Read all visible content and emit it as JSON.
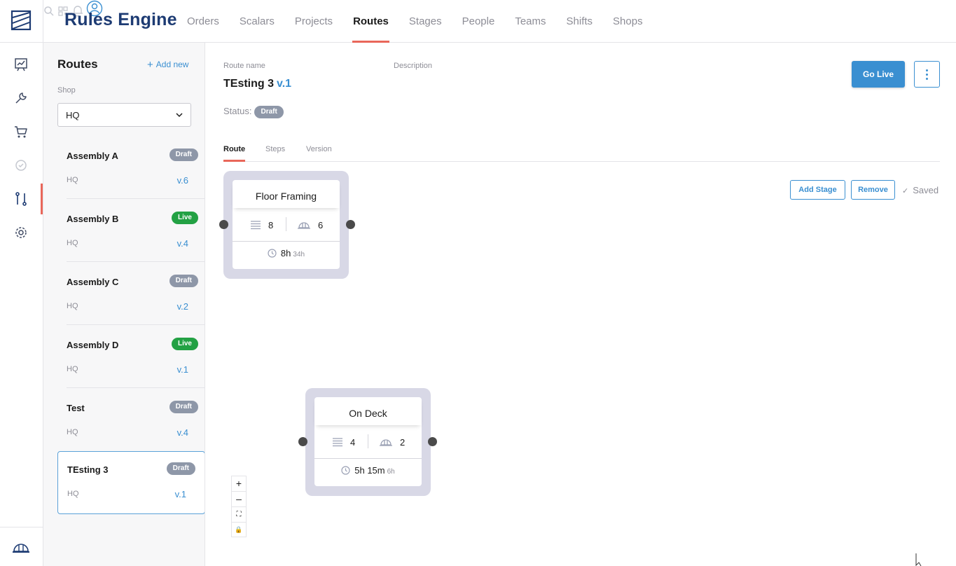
{
  "app": {
    "brand": "Rules Engine"
  },
  "nav": {
    "tabs": [
      {
        "label": "Orders"
      },
      {
        "label": "Scalars"
      },
      {
        "label": "Projects"
      },
      {
        "label": "Routes",
        "active": true
      },
      {
        "label": "Stages"
      },
      {
        "label": "People"
      },
      {
        "label": "Teams"
      },
      {
        "label": "Shifts"
      },
      {
        "label": "Shops"
      }
    ]
  },
  "rail": {
    "icons": [
      "dashboard-chart-icon",
      "wrench-icon",
      "cart-icon",
      "check-circle-icon",
      "routes-icon",
      "gear-icon",
      "hard-hat-icon"
    ],
    "active": "routes-icon"
  },
  "topicons": [
    "search-icon",
    "qr-code-icon",
    "bell-icon",
    "user-avatar-icon"
  ],
  "panel": {
    "title": "Routes",
    "add_new": "Add new",
    "shop_label": "Shop",
    "shop_value": "HQ",
    "items": [
      {
        "name": "Assembly A",
        "status": "Draft",
        "shop": "HQ",
        "version": "v.6"
      },
      {
        "name": "Assembly B",
        "status": "Live",
        "shop": "HQ",
        "version": "v.4"
      },
      {
        "name": "Assembly C",
        "status": "Draft",
        "shop": "HQ",
        "version": "v.2"
      },
      {
        "name": "Assembly D",
        "status": "Live",
        "shop": "HQ",
        "version": "v.1"
      },
      {
        "name": "Test",
        "status": "Draft",
        "shop": "HQ",
        "version": "v.4"
      },
      {
        "name": "TEsting 3",
        "status": "Draft",
        "shop": "HQ",
        "version": "v.1",
        "selected": true
      }
    ]
  },
  "route": {
    "name_label": "Route name",
    "description_label": "Description",
    "name": "TEsting 3",
    "version": "v.1",
    "status_label": "Status:",
    "status": "Draft",
    "go_live": "Go Live"
  },
  "subtabs": [
    {
      "label": "Route",
      "active": true
    },
    {
      "label": "Steps"
    },
    {
      "label": "Version"
    }
  ],
  "canvas": {
    "add_stage": "Add Stage",
    "remove": "Remove",
    "saved": "Saved",
    "zoom_controls": [
      "+",
      "–",
      "⛶",
      "🔒"
    ],
    "stages": [
      {
        "title": "Floor Framing",
        "steps": "8",
        "workers": "6",
        "time": "8h",
        "time_sub": "34h"
      },
      {
        "title": "On Deck",
        "steps": "4",
        "workers": "2",
        "time": "5h 15m",
        "time_sub": "6h"
      }
    ]
  },
  "colors": {
    "brand": "#1d3b73",
    "accent": "#3a8fd1",
    "active_tab": "#e9675a",
    "draft": "#8e97a8",
    "live": "#23a144",
    "node_bg": "#d8d8e6"
  }
}
